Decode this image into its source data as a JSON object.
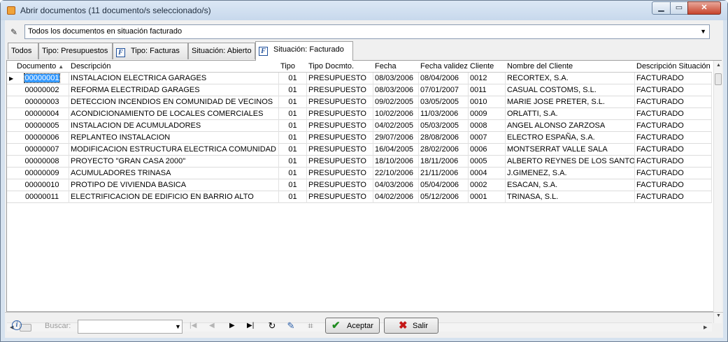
{
  "window": {
    "title": "Abrir documentos (11 documento/s seleccionado/s)",
    "minimize_glyph": "▁",
    "maximize_glyph": "▭",
    "close_glyph": "✕"
  },
  "filter": {
    "icon": "paint-brush-icon",
    "selected": "Todos los documentos en situación facturado"
  },
  "tabs": [
    {
      "label": "Todos",
      "icon": null
    },
    {
      "label": "Tipo: Presupuestos",
      "icon": null
    },
    {
      "label": "Tipo: Facturas",
      "icon": "f-doc-icon"
    },
    {
      "label": "Situación: Abierto",
      "icon": null
    },
    {
      "label": "Situación: Facturado",
      "icon": "f-doc-icon"
    }
  ],
  "active_tab": 4,
  "f_icon_glyph": "F",
  "grid": {
    "columns": [
      "Documento",
      "Descripción",
      "Tipo",
      "Tipo Docmto.",
      "Fecha",
      "Fecha validez",
      "Cliente",
      "Nombre del Cliente",
      "Descripción Situación"
    ],
    "sorted_column": "Documento",
    "sort_glyph": "▲",
    "selected_row": 0,
    "rows": [
      [
        "00000001",
        "INSTALACION ELECTRICA GARAGES",
        "01",
        "PRESUPUESTO",
        "08/03/2006",
        "08/04/2006",
        "0012",
        "RECORTEX, S.A.",
        "FACTURADO"
      ],
      [
        "00000002",
        "REFORMA ELECTRIDAD GARAGES",
        "01",
        "PRESUPUESTO",
        "08/03/2006",
        "07/01/2007",
        "0011",
        "CASUAL COSTOMS, S.L.",
        "FACTURADO"
      ],
      [
        "00000003",
        "DETECCION INCENDIOS EN COMUNIDAD DE VECINOS",
        "01",
        "PRESUPUESTO",
        "09/02/2005",
        "03/05/2005",
        "0010",
        "MARIE JOSE PRETER, S.L.",
        "FACTURADO"
      ],
      [
        "00000004",
        "ACONDICIONAMIENTO DE LOCALES COMERCIALES",
        "01",
        "PRESUPUESTO",
        "10/02/2006",
        "11/03/2006",
        "0009",
        "ORLATTI, S.A.",
        "FACTURADO"
      ],
      [
        "00000005",
        "INSTALACION DE ACUMULADORES",
        "01",
        "PRESUPUESTO",
        "04/02/2005",
        "05/03/2005",
        "0008",
        "ANGEL ALONSO ZARZOSA",
        "FACTURADO"
      ],
      [
        "00000006",
        "REPLANTEO INSTALACION",
        "01",
        "PRESUPUESTO",
        "29/07/2006",
        "28/08/2006",
        "0007",
        "ELECTRO ESPAÑA, S.A.",
        "FACTURADO"
      ],
      [
        "00000007",
        "MODIFICACION ESTRUCTURA ELECTRICA COMUNIDAD",
        "01",
        "PRESUPUESTO",
        "16/04/2005",
        "28/02/2006",
        "0006",
        "MONTSERRAT VALLE SALA",
        "FACTURADO"
      ],
      [
        "00000008",
        "PROYECTO \"GRAN CASA 2000\"",
        "01",
        "PRESUPUESTO",
        "18/10/2006",
        "18/11/2006",
        "0005",
        "ALBERTO REYNES DE LOS SANTOS",
        "FACTURADO"
      ],
      [
        "00000009",
        "ACUMULADORES TRINASA",
        "01",
        "PRESUPUESTO",
        "22/10/2006",
        "21/11/2006",
        "0004",
        "J.GIMENEZ, S.A.",
        "FACTURADO"
      ],
      [
        "00000010",
        "PROTIPO DE VIVIENDA BASICA",
        "01",
        "PRESUPUESTO",
        "04/03/2006",
        "05/04/2006",
        "0002",
        "ESACAN, S.A.",
        "FACTURADO"
      ],
      [
        "00000011",
        "ELECTRIFICACION DE EDIFICIO EN BARRIO ALTO",
        "01",
        "PRESUPUESTO",
        "04/02/2006",
        "05/12/2006",
        "0001",
        "TRINASA, S.L.",
        "FACTURADO"
      ]
    ]
  },
  "bottom": {
    "info_glyph": "i",
    "search_label": "Buscar:",
    "search_value": "",
    "nav": {
      "first": "|◀",
      "prev": "◀",
      "next": "▶",
      "last": "▶|"
    },
    "tools": {
      "refresh": "↻",
      "bookmark": "✎",
      "tag": "⌗"
    },
    "accept_label": "Aceptar",
    "accept_glyph": "✔",
    "exit_label": "Salir",
    "exit_glyph": "✖"
  },
  "colors": {
    "selection": "#3399ff",
    "titlebar": "#d6e2ef",
    "close": "#c7442c"
  }
}
